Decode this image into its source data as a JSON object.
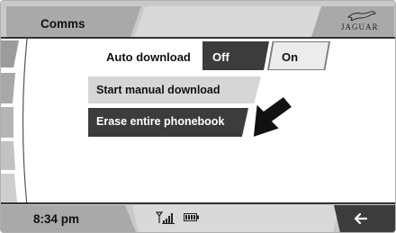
{
  "header": {
    "title": "Comms",
    "logo_text": "JAGUAR",
    "logo_icon": "jaguar-leaper-icon"
  },
  "settings": {
    "auto_download_label": "Auto download",
    "off_label": "Off",
    "on_label": "On",
    "selected": "Off"
  },
  "menu": {
    "start_manual_download": "Start manual download",
    "erase_phonebook": "Erase entire phonebook"
  },
  "footer": {
    "time": "8:34 pm",
    "signal_icon": "signal-strength-icon",
    "battery_icon": "battery-icon",
    "back_icon": "back-arrow-icon"
  },
  "colors": {
    "header_bg": "#c9c9c9",
    "selected_bg": "#3c3c3c",
    "unselected_bg": "#ececec",
    "highlight_bg": "#d6d6d6"
  }
}
